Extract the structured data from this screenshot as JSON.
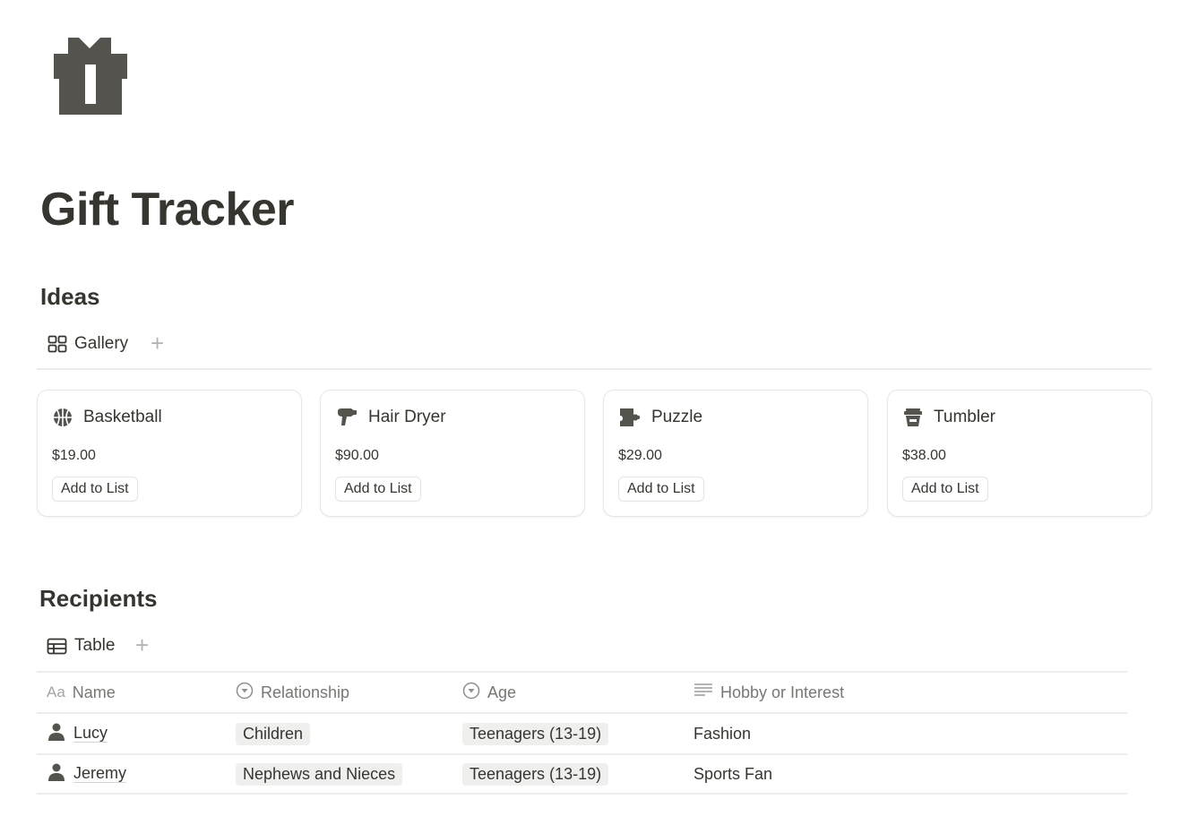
{
  "page": {
    "icon": "gift-icon",
    "title": "Gift Tracker"
  },
  "ideas": {
    "heading": "Ideas",
    "view": {
      "label": "Gallery",
      "icon": "gallery-grid-icon"
    },
    "add_view": "+",
    "cards": [
      {
        "title": "Basketball",
        "icon": "basketball-icon",
        "price": "$19.00",
        "button": "Add to List"
      },
      {
        "title": "Hair Dryer",
        "icon": "hair-dryer-icon",
        "price": "$90.00",
        "button": "Add to List"
      },
      {
        "title": "Puzzle",
        "icon": "puzzle-icon",
        "price": "$29.00",
        "button": "Add to List"
      },
      {
        "title": "Tumbler",
        "icon": "tumbler-icon",
        "price": "$38.00",
        "button": "Add to List"
      }
    ]
  },
  "recipients": {
    "heading": "Recipients",
    "view": {
      "label": "Table",
      "icon": "table-icon"
    },
    "add_view": "+",
    "columns": [
      {
        "label": "Name",
        "icon_text": "Aa"
      },
      {
        "label": "Relationship",
        "icon": "select-icon"
      },
      {
        "label": "Age",
        "icon": "select-icon"
      },
      {
        "label": "Hobby or Interest",
        "icon": "text-icon"
      }
    ],
    "rows": [
      {
        "name": "Lucy",
        "relationship": "Children",
        "age": "Teenagers (13-19)",
        "hobby": "Fashion"
      },
      {
        "name": "Jeremy",
        "relationship": "Nephews and Nieces",
        "age": "Teenagers (13-19)",
        "hobby": "Sports Fan"
      }
    ]
  },
  "colors": {
    "text": "#37352f",
    "muted": "#787774",
    "icon": "#55534e",
    "tag_bg": "#efefed",
    "border": "#ececeb"
  }
}
